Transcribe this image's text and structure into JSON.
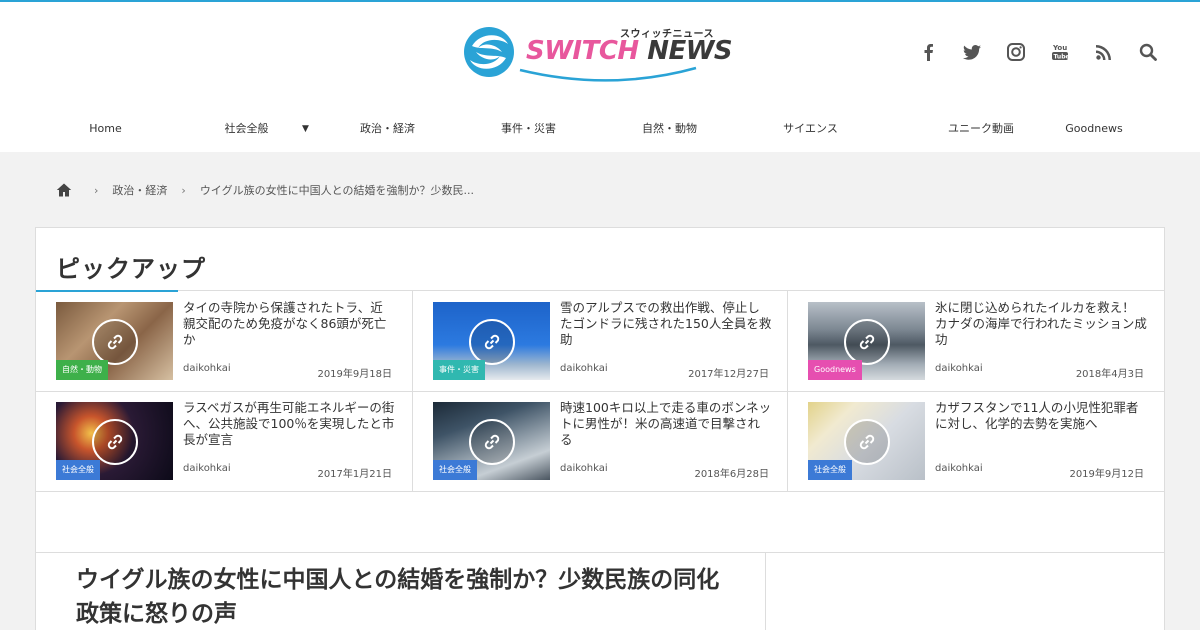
{
  "brand": {
    "kana": "スウィッチニュース",
    "word_switch": "SWITCH",
    "word_news": "NEWS",
    "colors": {
      "pink": "#e8579d",
      "blue": "#2aa3d6",
      "dark": "#3a3a3a"
    }
  },
  "social_icons": [
    "facebook-icon",
    "twitter-icon",
    "instagram-icon",
    "youtube-icon",
    "rss-icon",
    "search-icon"
  ],
  "nav": {
    "items": [
      "Home",
      "社会全般",
      "政治・経済",
      "事件・災害",
      "自然・動物",
      "サイエンス",
      "ユニーク動画",
      "Goodnews"
    ],
    "dropdown_marker": "▼"
  },
  "breadcrumb": {
    "home_icon": "home-icon",
    "items": [
      "政治・経済",
      "ウイグル族の女性に中国人との結婚を強制か？少数民..."
    ]
  },
  "pickup": {
    "title": "ピックアップ",
    "cards": [
      {
        "title": "タイの寺院から保護されたトラ、近親交配のため免疫がなく86頭が死亡か",
        "author": "daikohkai",
        "date": "2019年9月18日",
        "category": "自然・動物",
        "badge_color": "#3eb04a"
      },
      {
        "title": "雪のアルプスでの救出作戦、停止したゴンドラに残された150人全員を救助",
        "author": "daikohkai",
        "date": "2017年12月27日",
        "category": "事件・災害",
        "badge_color": "#30b8b0"
      },
      {
        "title": "氷に閉じ込められたイルカを救え！カナダの海岸で行われたミッション成功",
        "author": "daikohkai",
        "date": "2018年4月3日",
        "category": "Goodnews",
        "badge_color": "#e64fb0"
      },
      {
        "title": "ラスベガスが再生可能エネルギーの街へ、公共施設で100％を実現したと市長が宣言",
        "author": "daikohkai",
        "date": "2017年1月21日",
        "category": "社会全般",
        "badge_color": "#3c7ad6"
      },
      {
        "title": "時速100キロ以上で走る車のボンネットに男性が！米の高速道で目撃される",
        "author": "daikohkai",
        "date": "2018年6月28日",
        "category": "社会全般",
        "badge_color": "#3c7ad6"
      },
      {
        "title": "カザフスタンで11人の小児性犯罪者に対し、化学的去勢を実施へ",
        "author": "daikohkai",
        "date": "2019年9月12日",
        "category": "社会全般",
        "badge_color": "#3c7ad6"
      }
    ]
  },
  "article": {
    "title": "ウイグル族の女性に中国人との結婚を強制か？少数民族の同化政策に怒りの声"
  }
}
